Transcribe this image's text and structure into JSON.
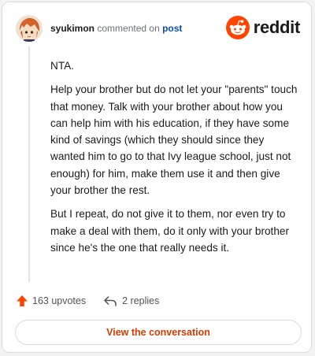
{
  "comment": {
    "username": "syukimon",
    "action_text": "commented on",
    "post_link": "post",
    "body": [
      "NTA.",
      "Help your brother but do not let your \"parents\" touch that money. Talk with your brother about how you can help him with his education, if they have some kind of savings (which they should since they wanted him to go to that Ivy league school, just not enough) for him, make them use it and then give your brother the rest.",
      "But I repeat, do not give it to them, nor even try to make a deal with them, do it only with your brother since he's the one that really needs it."
    ]
  },
  "brand": {
    "name": "reddit",
    "logo_icon": "reddit-alien-icon",
    "accent": "#ff4500"
  },
  "footer": {
    "upvotes_label": "163 upvotes",
    "replies_label": "2 replies",
    "upvote_icon": "upvote-arrow-icon",
    "reply_icon": "reply-arrow-icon"
  },
  "cta": {
    "label": "View the conversation",
    "color": "#d83a00"
  }
}
